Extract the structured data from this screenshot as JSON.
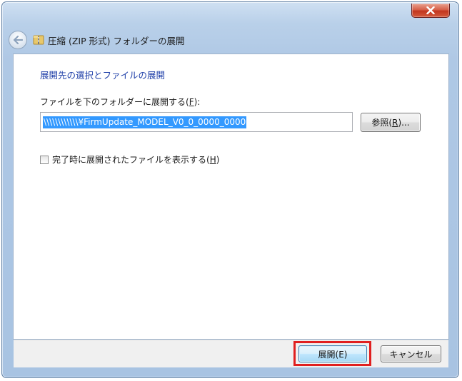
{
  "window": {
    "title": "圧縮 (ZIP 形式) フォルダーの展開",
    "close_icon": "close-x-icon"
  },
  "icons": {
    "back": "back-arrow-icon",
    "zip_folder": "zip-folder-icon"
  },
  "content": {
    "heading": "展開先の選択とファイルの展開",
    "path_label_prefix": "ファイルを下のフォルダーに展開する(",
    "path_label_accel": "F",
    "path_label_suffix": "):",
    "path_value": "\\\\\\\\\\\\\\\\\\\\\\\\¥FirmUpdate_MODEL_V0_0_0000_0000",
    "browse_prefix": "参照(",
    "browse_accel": "R",
    "browse_suffix": ")...",
    "checkbox_checked": false,
    "checkbox_prefix": "完了時に展開されたファイルを表示する(",
    "checkbox_accel": "H",
    "checkbox_suffix": ")"
  },
  "footer": {
    "extract_label": "展開(E)",
    "cancel_label": "キャンセル",
    "highlight_color": "#e02020"
  }
}
